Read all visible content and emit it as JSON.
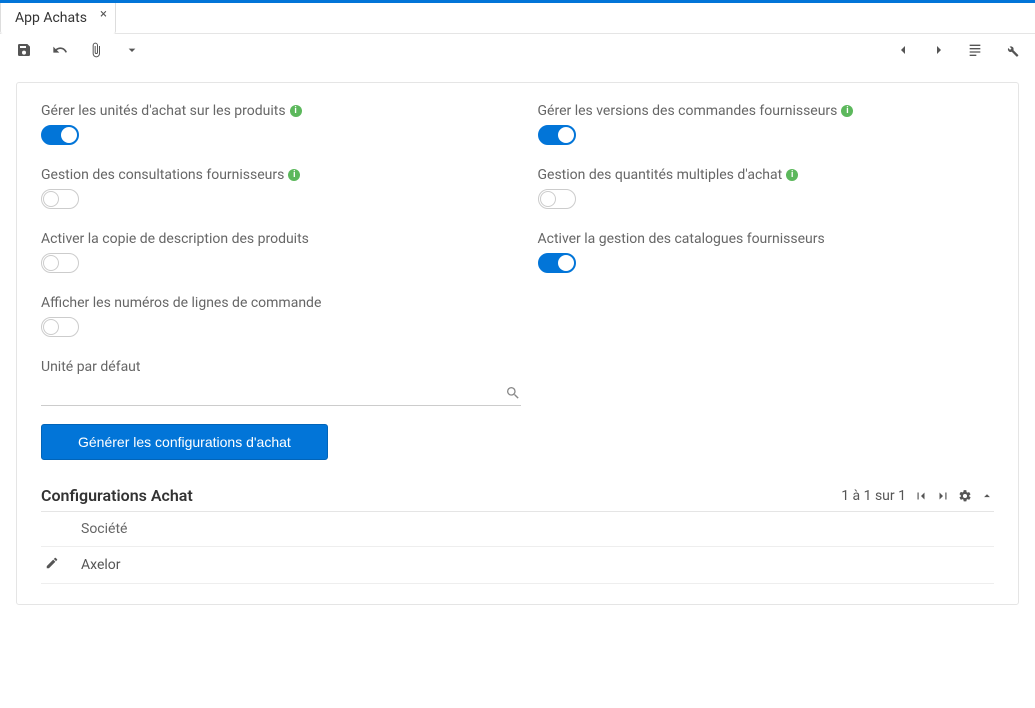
{
  "tab": {
    "label": "App Achats"
  },
  "settings": {
    "left": [
      {
        "label": "Gérer les unités d'achat sur les produits",
        "info": true,
        "on": true
      },
      {
        "label": "Gestion des consultations fournisseurs",
        "info": true,
        "on": false
      },
      {
        "label": "Activer la copie de description des produits",
        "info": false,
        "on": false
      },
      {
        "label": "Afficher les numéros de lignes de commande",
        "info": false,
        "on": false
      }
    ],
    "right": [
      {
        "label": "Gérer les versions des commandes fournisseurs",
        "info": true,
        "on": true
      },
      {
        "label": "Gestion des quantités multiples d'achat",
        "info": true,
        "on": false
      },
      {
        "label": "Activer la gestion des catalogues fournisseurs",
        "info": false,
        "on": true
      }
    ]
  },
  "unit": {
    "label": "Unité par défaut",
    "value": ""
  },
  "button": {
    "label": "Générer les configurations d'achat"
  },
  "section": {
    "title": "Configurations Achat",
    "pager": "1 à 1 sur 1",
    "columns": [
      "Société"
    ],
    "rows": [
      {
        "Société": "Axelor"
      }
    ]
  },
  "icons": {
    "save": "save-icon",
    "undo": "undo-icon",
    "attach": "attach-icon",
    "caret": "caret-down-icon",
    "prev": "prev-icon",
    "next": "next-icon",
    "list": "list-icon",
    "wrench": "wrench-icon",
    "first": "first-page-icon",
    "last": "last-page-icon",
    "gear": "gear-icon",
    "collapse": "collapse-icon",
    "edit": "edit-icon",
    "search": "search-icon"
  }
}
